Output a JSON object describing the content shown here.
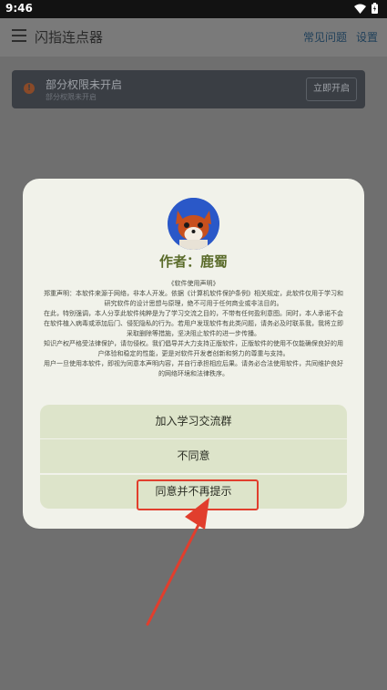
{
  "status_bar": {
    "time": "9:46"
  },
  "app_bar": {
    "title": "闪指连点器",
    "faq": "常见问题",
    "settings": "设置"
  },
  "permission_banner": {
    "title": "部分权限未开启",
    "subtitle": "部分权限未开启",
    "button": "立即开启"
  },
  "dialog": {
    "author_label": "作者：",
    "author_name": "鹿蜀",
    "declaration": [
      "《软件使用声明》",
      "郑重声明：本软件来源于网络，非本人开发。依据《计算机软件保护条例》相关规定，此软件仅用于学习和研究软件的设计思想与原理，绝不可用于任何商业或非法目的。",
      "在此，特别强调，本人分享此软件纯粹是为了学习交流之目的，不带有任何盈利意图。同时，本人承诺不会在软件植入病毒或添加后门、侵犯隐私的行为。若用户发现软件有此类问题，请务必及时联系我，我将立即采取删除等措施，坚决阻止软件的进一步传播。",
      "知识产权严格受法律保护，请勿侵权。我们倡导并大力支持正版软件，正版软件的使用不仅能确保良好的用户体验和稳定的性能，更是对软件开发者创新和努力的尊重与支持。",
      "用户一旦使用本软件，即视为同意本声明内容，并自行承担相应后果。请务必合法使用软件，共同维护良好的网络环境和法律秩序。"
    ],
    "buttons": {
      "join": "加入学习交流群",
      "disagree": "不同意",
      "agree": "同意并不再提示"
    }
  },
  "colors": {
    "highlight": "#e13e2d",
    "dialog_bg": "#f1f2ea",
    "button_bg": "#dde4ca"
  }
}
